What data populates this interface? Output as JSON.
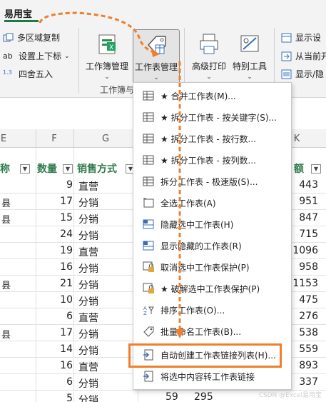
{
  "tabs": {
    "active": "易用宝"
  },
  "ribbon": {
    "multi_copy": "多区域复制",
    "superscript": "设置上下标",
    "round": "四舍五入",
    "workbook_mgr": "工作簿管理",
    "worktable_mgr": "工作表管理",
    "advanced_print": "高级打印",
    "special_tools": "特别工具",
    "group_label": "工作簿与",
    "show_label": "显示设",
    "from_current": "从当前开",
    "show_hide": "显示/隐"
  },
  "sheet": {
    "col_letters": {
      "e": "E",
      "f": "F",
      "g": "G",
      "k": "K"
    },
    "headers": {
      "e": "称",
      "f": "数量",
      "g": "销售方式",
      "k": "额"
    },
    "rows": [
      {
        "e": "",
        "f": "9",
        "g": "直营",
        "k": "443"
      },
      {
        "e": "县",
        "f": "17",
        "g": "分销",
        "k": "951"
      },
      {
        "e": "县",
        "f": "15",
        "g": "分销",
        "k": "847"
      },
      {
        "e": "",
        "f": "24",
        "g": "分销",
        "k": "715"
      },
      {
        "e": "",
        "f": "19",
        "g": "直营",
        "k": "1096"
      },
      {
        "e": "",
        "f": "16",
        "g": "分销",
        "k": "958"
      },
      {
        "e": "县",
        "f": "21",
        "g": "分销",
        "k": "1153"
      },
      {
        "e": "",
        "f": "10",
        "g": "分销",
        "k": "475"
      },
      {
        "e": "",
        "f": "6",
        "g": "直营",
        "k": "276"
      },
      {
        "e": "县",
        "f": "17",
        "g": "分销",
        "k": "538"
      },
      {
        "e": "",
        "f": "14",
        "g": "分销",
        "k": "559"
      },
      {
        "e": "",
        "f": "16",
        "g": "直营",
        "k": "893"
      },
      {
        "e": "",
        "f": "6",
        "g": "分销",
        "k": "337"
      },
      {
        "e": "",
        "f": "5",
        "g": "分销",
        "k": ""
      }
    ],
    "extra_values": {
      "mid_59": "59",
      "mid_295": "295",
      "k_last": ""
    }
  },
  "menu": {
    "items": [
      {
        "label": "★ 合并工作表(M)...",
        "icon": "merge-sheets-icon"
      },
      {
        "label": "★ 拆分工作表 - 按关键字(S)...",
        "icon": "split-by-key-icon"
      },
      {
        "label": "★ 拆分工作表 - 按行数...",
        "icon": "split-by-rows-icon"
      },
      {
        "label": "★ 拆分工作表 - 按列数...",
        "icon": "split-by-cols-icon"
      },
      {
        "label": "拆分工作表 - 极速版(S)...",
        "icon": "split-fast-icon"
      },
      {
        "label": "全选工作表(A)",
        "icon": "select-all-sheets-icon"
      },
      {
        "label": "隐藏选中工作表(H)",
        "icon": "hide-sheets-icon"
      },
      {
        "label": "显示隐藏的工作表(R)",
        "icon": "show-hidden-sheets-icon"
      },
      {
        "label": "取消选中工作表保护(P)",
        "icon": "unprotect-sheet-icon"
      },
      {
        "label": "★ 破解选中工作表保护(P)",
        "icon": "crack-protection-icon"
      },
      {
        "label": "排序工作表(O)...",
        "icon": "sort-sheets-icon"
      },
      {
        "label": "批量命名工作表(B)...",
        "icon": "batch-rename-icon"
      },
      {
        "label": "自动创建工作表链接列表(H)...",
        "icon": "auto-link-list-icon"
      },
      {
        "label": "将选中内容转工作表链接",
        "icon": "convert-to-link-icon"
      }
    ]
  },
  "watermark": "CSDN @Excel易用宝",
  "colors": {
    "highlight": "#ee7f2d",
    "header_green": "#2f7a4c",
    "tab_green": "#1e7a45"
  }
}
